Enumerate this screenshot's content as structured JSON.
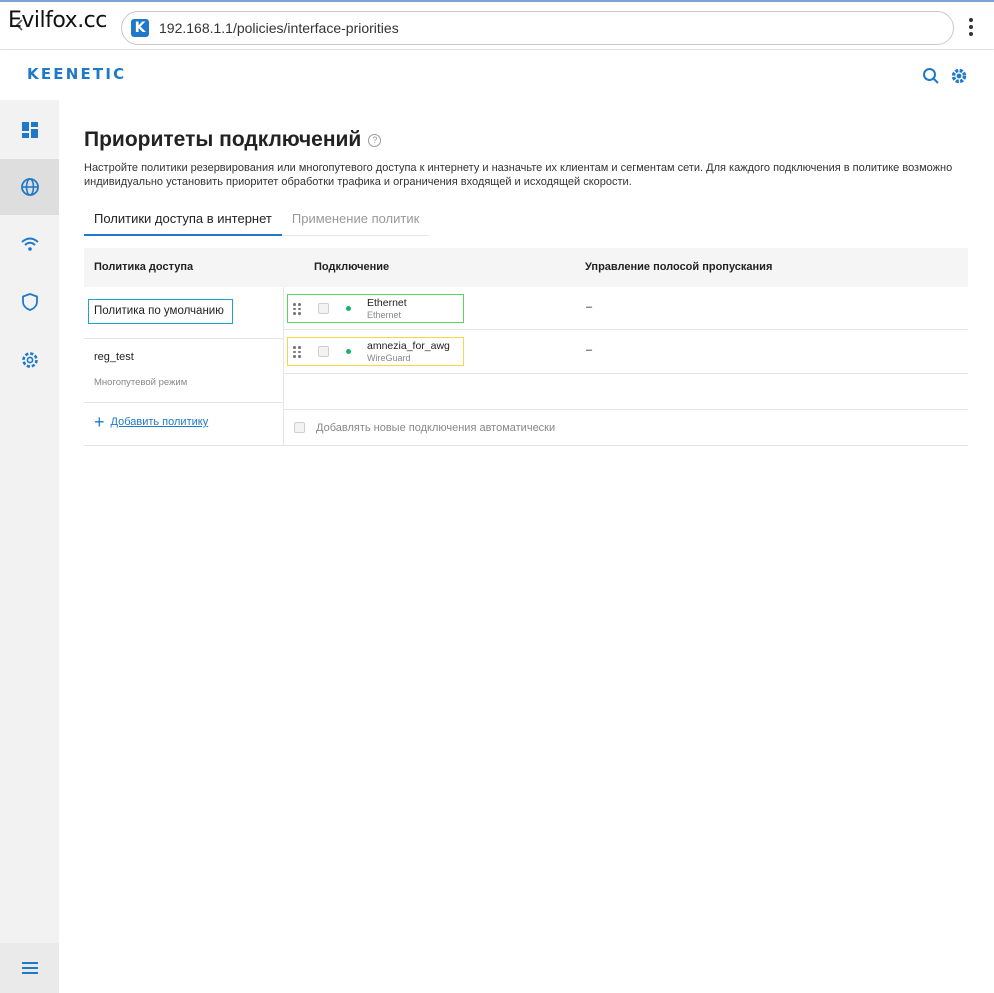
{
  "browser": {
    "watermark": "Evilfox.cc",
    "favicon_letter": "K",
    "url": "192.168.1.1/policies/interface-priorities"
  },
  "app": {
    "logo": "KEENETIC",
    "accent_color": "#1f79c8"
  },
  "sidebar": {
    "items": [
      {
        "name": "dashboard",
        "icon": "dashboard-icon",
        "active": false
      },
      {
        "name": "internet",
        "icon": "globe-icon",
        "active": true
      },
      {
        "name": "wifi",
        "icon": "wifi-icon",
        "active": false
      },
      {
        "name": "security",
        "icon": "shield-icon",
        "active": false
      },
      {
        "name": "settings",
        "icon": "gear-icon",
        "active": false
      }
    ],
    "bottom_icon": "menu-icon"
  },
  "page": {
    "title": "Приоритеты подключений",
    "help_glyph": "?",
    "description": "Настройте политики резервирования или многопутевого доступа к интернету и назначьте их клиентам и сегментам сети. Для каждого подключения в политике возможно индивидуально установить приоритет обработки трафика и ограничения входящей и исходящей скорости."
  },
  "tabs": [
    {
      "label": "Политики доступа в интернет",
      "active": true
    },
    {
      "label": "Применение политик",
      "active": false
    }
  ],
  "table": {
    "headers": {
      "policy": "Политика доступа",
      "connection": "Подключение",
      "bandwidth": "Управление полосой пропускания"
    },
    "policies": [
      {
        "name": "Политика по умолчанию",
        "mode": "",
        "selected": true
      },
      {
        "name": "reg_test",
        "mode": "Многопутевой режим",
        "selected": false
      }
    ],
    "add_policy_label": "Добавить политику",
    "connections": [
      {
        "name": "Ethernet",
        "type": "Ethernet",
        "bandwidth": "–",
        "status_color": "#19b46b",
        "highlight": "#5bd45b"
      },
      {
        "name": "amnezia_for_awg",
        "type": "WireGuard",
        "bandwidth": "–",
        "status_color": "#19b46b",
        "highlight": "#f2d84a"
      }
    ],
    "auto_add_label": "Добавлять новые подключения автоматически"
  }
}
